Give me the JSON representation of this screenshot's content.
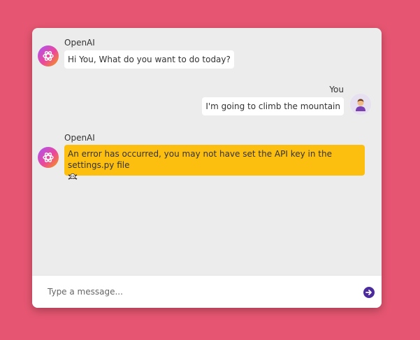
{
  "messages": [
    {
      "sender": "OpenAI",
      "text": "Hi You, What do you want to do today?"
    },
    {
      "sender": "You",
      "text": "I'm going to climb the mountain"
    },
    {
      "sender": "OpenAI",
      "text": "An error has occurred, you may not have set the API key in the settings.py file",
      "icon": "skull-crossbones-icon"
    }
  ],
  "input": {
    "placeholder": "Type a message..."
  },
  "colors": {
    "background": "#e65672",
    "chat_background": "#ececec",
    "error_bubble": "#fdbf0f",
    "send_button": "#4c2b9a"
  }
}
